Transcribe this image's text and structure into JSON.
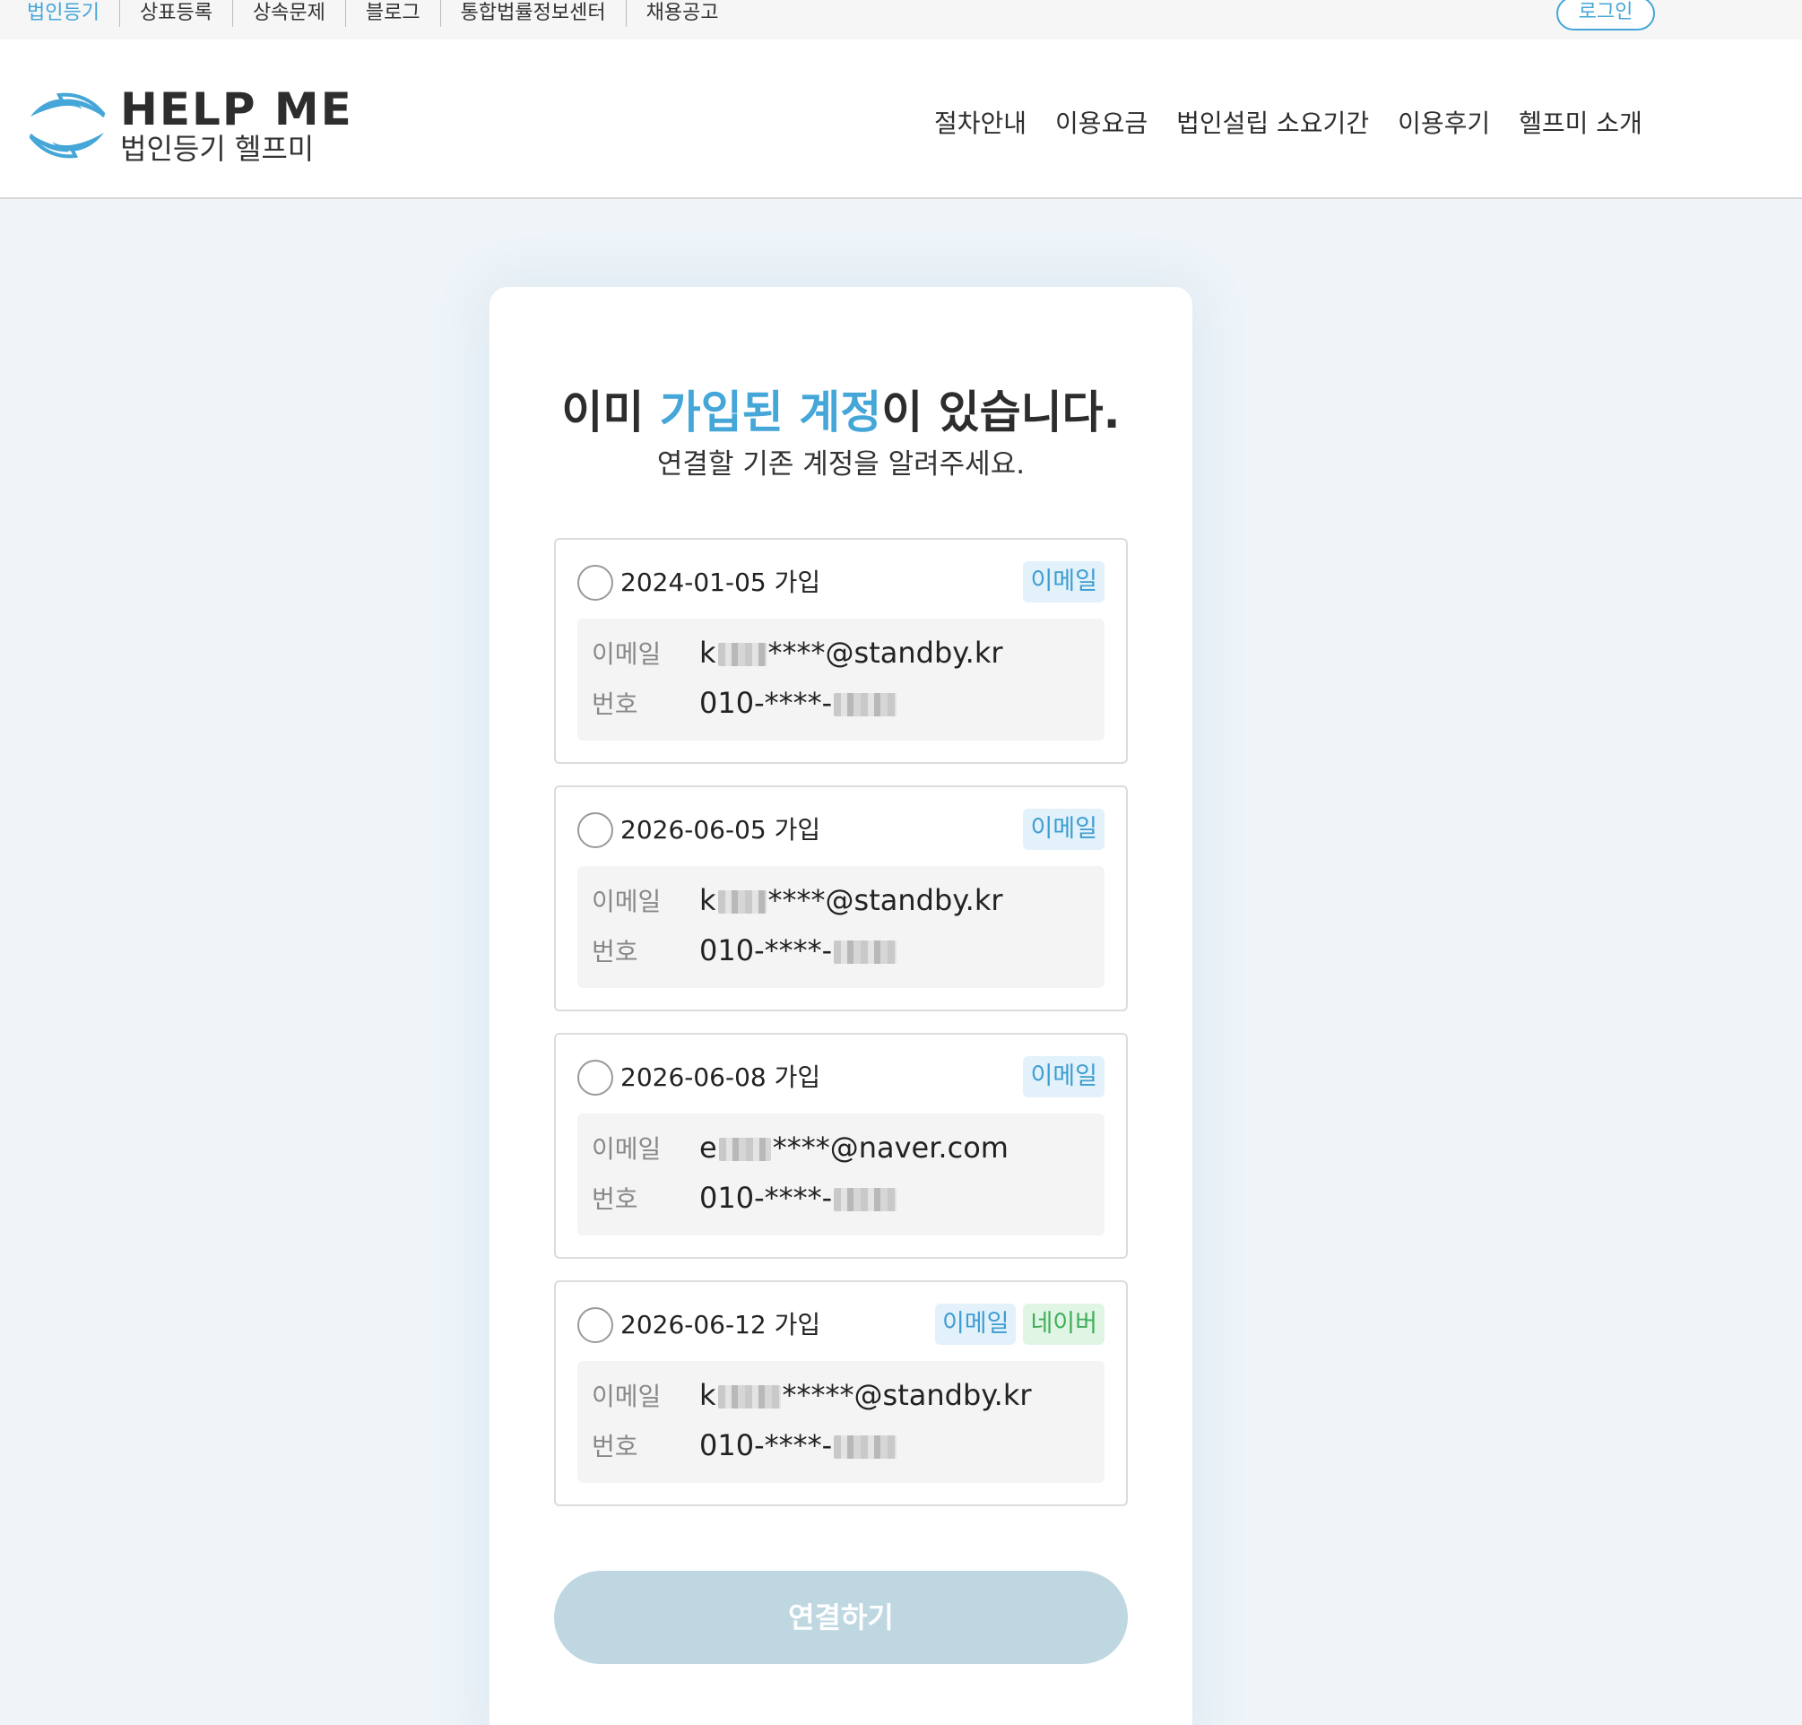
{
  "topbar": {
    "links": [
      "법인등기",
      "상표등록",
      "상속문제",
      "블로그",
      "통합법률정보센터",
      "채용공고"
    ],
    "login": "로그인"
  },
  "header": {
    "brand_en": "HELP ME",
    "brand_ko": "법인등기 헬프미",
    "nav": [
      "절차안내",
      "이용요금",
      "법인설립 소요기간",
      "이용후기",
      "헬프미 소개"
    ]
  },
  "main": {
    "title_pre": "이미 ",
    "title_accent": "가입된 계정",
    "title_post": "이 있습니다.",
    "subtitle": "연결할 기존 계정을 알려주세요.",
    "email_label": "이메일",
    "phone_label": "번호",
    "accounts": [
      {
        "date": "2024-01-05 가입",
        "badges": [
          "이메일"
        ],
        "email_prefix": "k",
        "email_suffix": "****@standby.kr",
        "phone_prefix": "010-****-"
      },
      {
        "date": "2026-06-05 가입",
        "badges": [
          "이메일"
        ],
        "email_prefix": "k",
        "email_suffix": "****@standby.kr",
        "phone_prefix": "010-****-"
      },
      {
        "date": "2026-06-08 가입",
        "badges": [
          "이메일"
        ],
        "email_prefix": "e",
        "email_suffix": "****@naver.com",
        "phone_prefix": "010-****-"
      },
      {
        "date": "2026-06-12 가입",
        "badges": [
          "이메일",
          "네이버"
        ],
        "email_prefix": "k",
        "email_suffix": "*****@standby.kr",
        "phone_prefix": "010-****-"
      }
    ],
    "connect_button": "연결하기"
  },
  "colors": {
    "accent": "#45a6d8",
    "naver": "#3fae5a",
    "button_disabled": "#bed7e1"
  }
}
